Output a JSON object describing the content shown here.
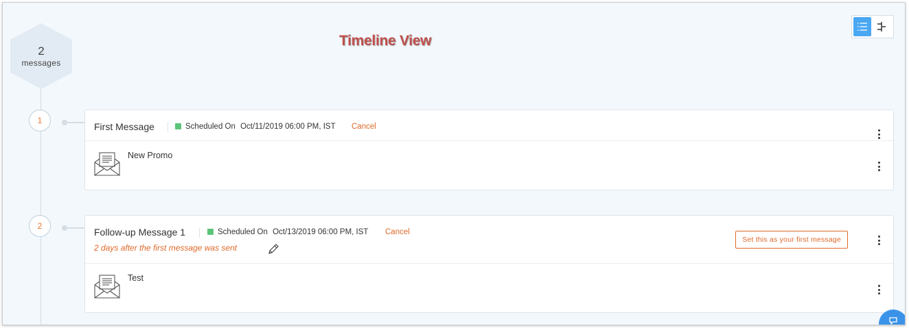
{
  "header": {
    "message_count": "2",
    "message_count_label": "messages",
    "title": "Timeline View"
  },
  "view_toggle": {
    "active": "list-view",
    "options": [
      "list-view-icon",
      "timeline-view-icon"
    ]
  },
  "messages": [
    {
      "step": "1",
      "title": "First Message",
      "status": "Scheduled On",
      "scheduled": "Oct/11/2019 06:00 PM, IST",
      "cancel_label": "Cancel",
      "content_name": "New Promo"
    },
    {
      "step": "2",
      "title": "Follow-up Message 1",
      "status": "Scheduled On",
      "scheduled": "Oct/13/2019 06:00 PM, IST",
      "cancel_label": "Cancel",
      "delay_text": "2  days after the first message was sent",
      "set_first_label": "Set this as your first message",
      "content_name": "Test"
    }
  ],
  "colors": {
    "accent_orange": "#e0692b",
    "status_green": "#5cc47a",
    "toggle_blue": "#4aa8f3",
    "title_red": "#c0504d"
  }
}
